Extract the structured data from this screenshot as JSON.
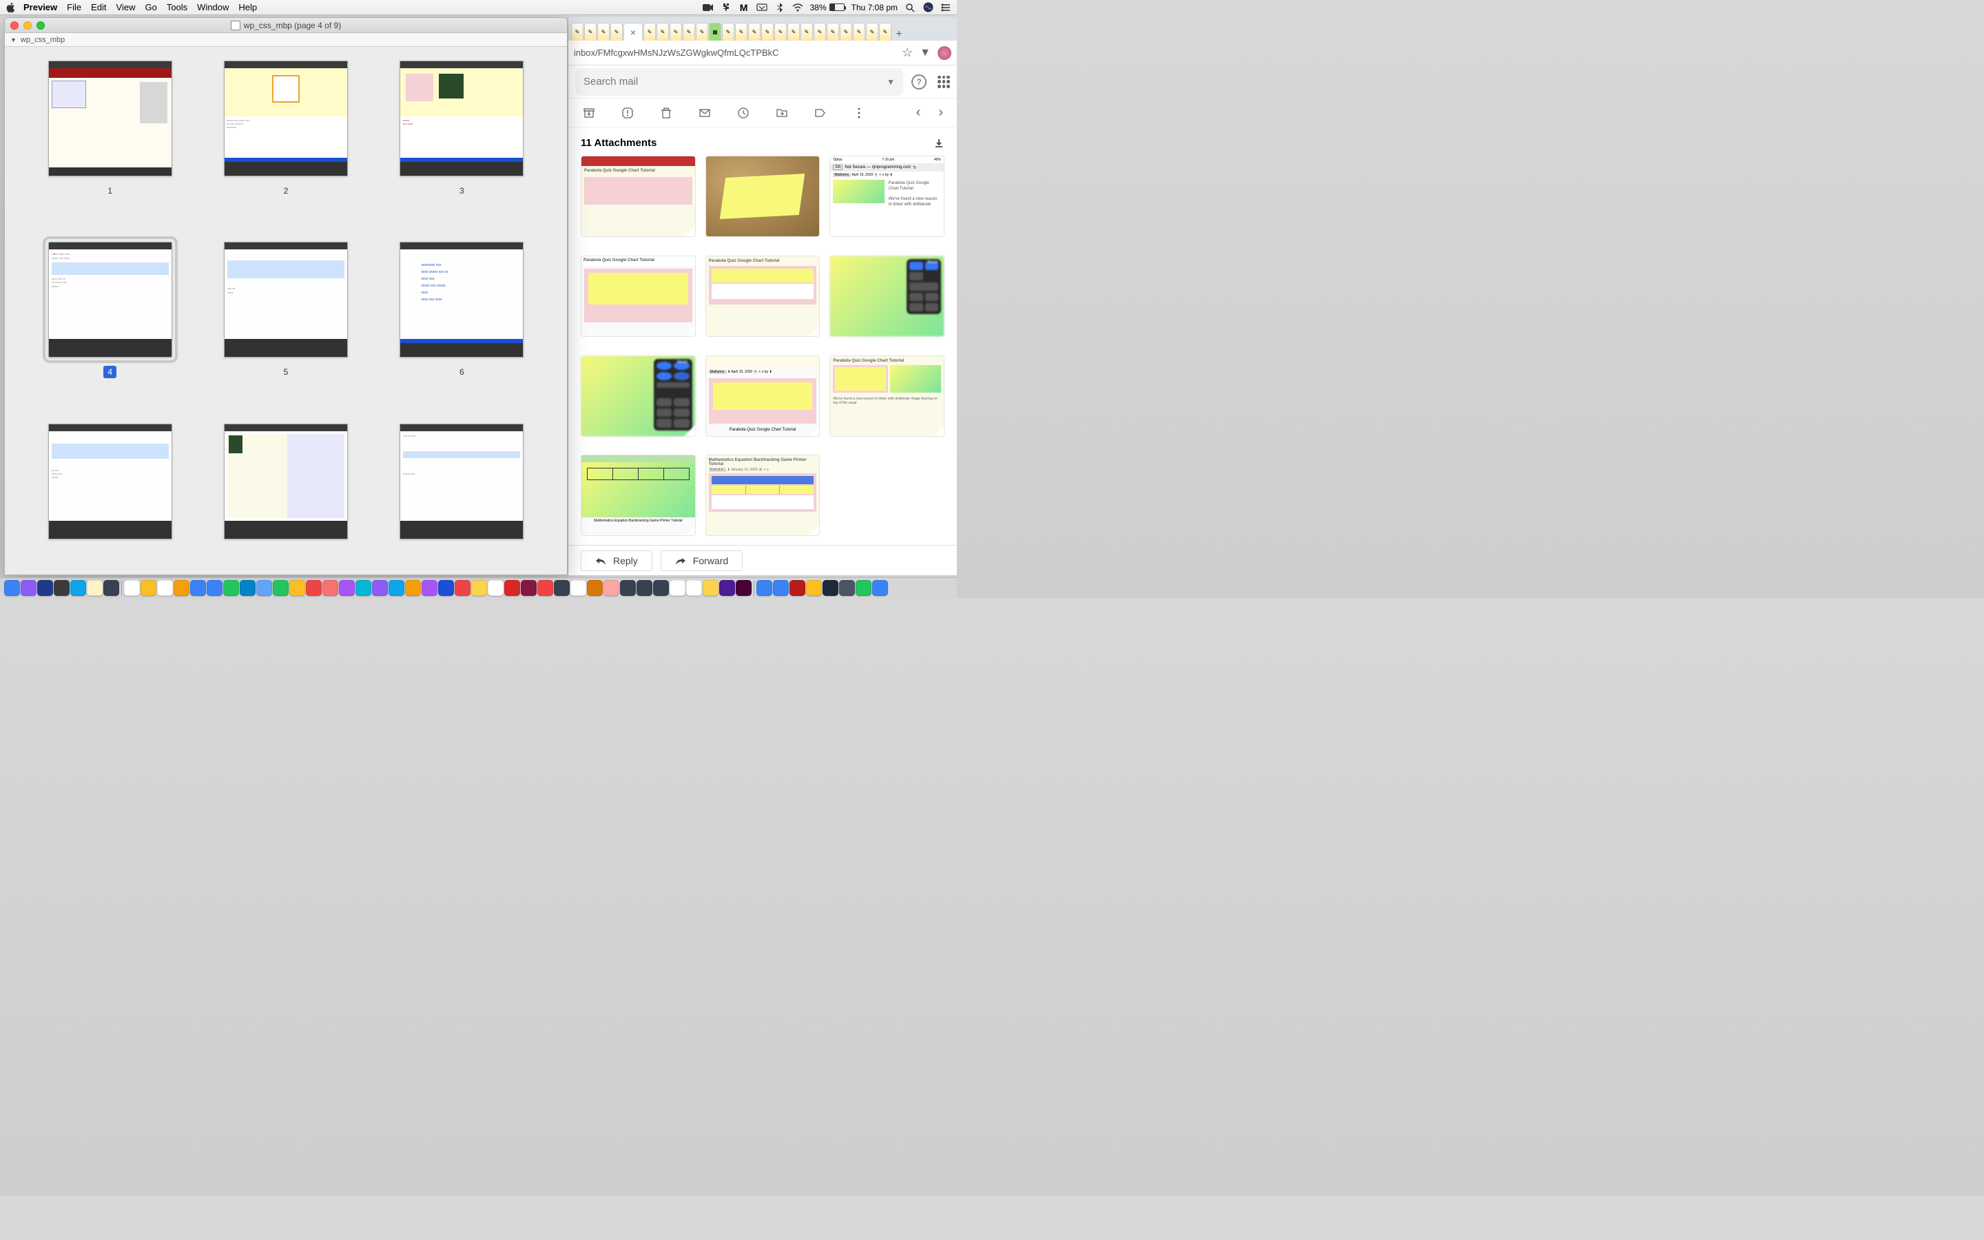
{
  "menubar": {
    "app_name": "Preview",
    "items": [
      "File",
      "Edit",
      "View",
      "Go",
      "Tools",
      "Window",
      "Help"
    ],
    "battery_pct": "38%",
    "clock": "Thu 7:08 pm"
  },
  "preview": {
    "window_title": "wp_css_mbp (page 4 of 9)",
    "sidebar_label": "wp_css_mbp",
    "thumbnails": [
      {
        "label": "1",
        "selected": false
      },
      {
        "label": "2",
        "selected": false
      },
      {
        "label": "3",
        "selected": false
      },
      {
        "label": "4",
        "selected": true
      },
      {
        "label": "5",
        "selected": false
      },
      {
        "label": "6",
        "selected": false
      },
      {
        "label": "",
        "selected": false
      },
      {
        "label": "",
        "selected": false
      },
      {
        "label": "",
        "selected": false
      }
    ]
  },
  "gmail": {
    "tab_close": "×",
    "new_tab": "+",
    "address": "inbox/FMfcgxwHMsNJzWsZGWgkwQfmLQcTPBkC",
    "search_placeholder": "Search mail",
    "attachments_title": "11 Attachments",
    "reply_label": "Reply",
    "forward_label": "Forward",
    "attachments": [
      {
        "caption": ""
      },
      {
        "caption": ""
      },
      {
        "caption": "We've found a new reason to tinker with deliberate",
        "header": "Not Secure — rjmprogramming.com",
        "status": "Optus",
        "time": "7:16 pm",
        "batt": "49%",
        "title": "Parabola Quiz Google Chart Tutorial",
        "date": "April 15, 2020",
        "by": "by"
      },
      {
        "caption": "",
        "title": "Parabola Quiz Google Chart Tutorial"
      },
      {
        "caption": "",
        "title": "Parabola Quiz Google Chart Tutorial"
      },
      {
        "caption": "",
        "label": "Music"
      },
      {
        "caption": "",
        "label": "Music"
      },
      {
        "caption": "Parabola Quiz Google Chart Tutorial",
        "date": "April 15, 2020",
        "cat": "Mathems.",
        "by": "by"
      },
      {
        "caption": "Parabola Quiz Google Chart Tutorial",
        "title": "Parabola Quiz Google Chart Tutorial",
        "found": "We've found a new reason to tinker with deliberate image blurring on top of the usual"
      },
      {
        "caption": "Mathematics Equation Backtracking Game Primer Tutorial"
      },
      {
        "caption": "",
        "title": "Mathematics Equation Backtracking Game Primer Tutorial",
        "month": "End of d..",
        "date": "January 13, 2020"
      }
    ]
  },
  "dock": {
    "icon_colors": [
      "#3b82f6",
      "#8b5cf6",
      "#1e3a8a",
      "#3b3b3b",
      "#0ea5e9",
      "#fef3c7",
      "#374151",
      "#fff",
      "#fbbf24",
      "#fff",
      "#f59e0b",
      "#3b82f6",
      "#3b82f6",
      "#22c55e",
      "#0284c7",
      "#60a5fa",
      "#22c55e",
      "#fbbf24",
      "#ef4444",
      "#f87171",
      "#a855f7",
      "#06b6d4",
      "#8b5cf6",
      "#0ea5e9",
      "#f59e0b",
      "#a855f7",
      "#1d4ed8",
      "#ef4444",
      "#fcd34d",
      "#fff",
      "#dc2626",
      "#831843",
      "#ef4444",
      "#374151",
      "#fff",
      "#d97706",
      "#fca5a5",
      "#374151",
      "#374151",
      "#374151",
      "#fff",
      "#fff",
      "#fcd34d",
      "#4c1d95",
      "#470137",
      "#3b82f6",
      "#3b82f6",
      "#b91c1c",
      "#fbbf24",
      "#1e293b",
      "#4b5563",
      "#22c55e",
      "#3b82f6"
    ]
  }
}
